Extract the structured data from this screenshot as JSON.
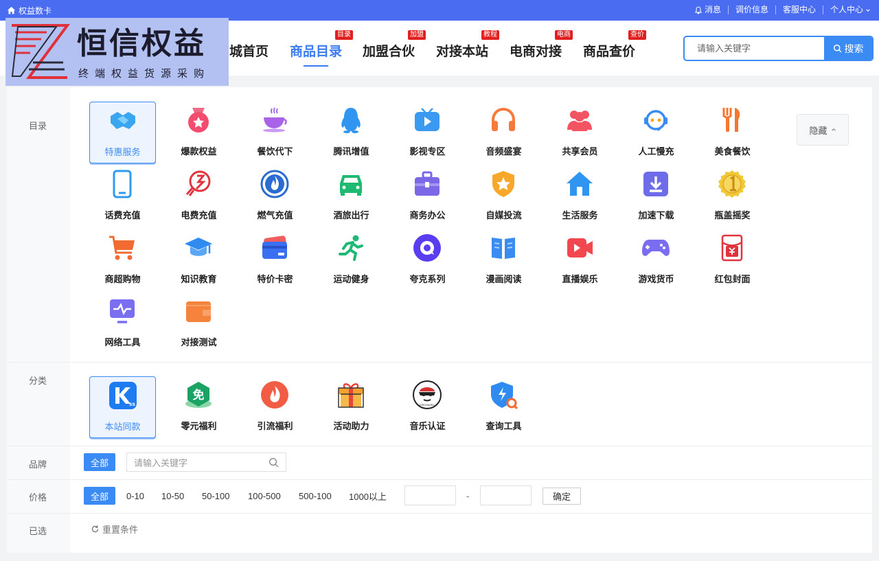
{
  "topbar": {
    "site_name": "权益数卡",
    "links": [
      {
        "label": "消息",
        "icon": "bell-icon"
      },
      {
        "label": "调价信息"
      },
      {
        "label": "客服中心"
      },
      {
        "label": "个人中心",
        "icon": "chevron-down-icon"
      }
    ]
  },
  "logo": {
    "title": "恒信权益",
    "subtitle": "终端权益货源采购",
    "bg_color": "#b2c1f2"
  },
  "nav": [
    {
      "label": "城首页",
      "tag": ""
    },
    {
      "label": "商品目录",
      "tag": "目录",
      "active": true
    },
    {
      "label": "加盟合伙",
      "tag": "加盟"
    },
    {
      "label": "对接本站",
      "tag": "教程"
    },
    {
      "label": "电商对接",
      "tag": "电商"
    },
    {
      "label": "商品查价",
      "tag": "查价"
    }
  ],
  "search": {
    "placeholder": "请输入关键字",
    "button": "搜索"
  },
  "catalog": {
    "label": "目录",
    "hide_label": "隐藏",
    "items": [
      {
        "label": "特惠服务",
        "icon": "handshake-icon",
        "selected": true
      },
      {
        "label": "爆款权益",
        "icon": "medal-icon"
      },
      {
        "label": "餐饮代下",
        "icon": "coffee-cup-icon"
      },
      {
        "label": "腾讯增值",
        "icon": "qq-penguin-icon"
      },
      {
        "label": "影视专区",
        "icon": "tv-play-icon"
      },
      {
        "label": "音频盛宴",
        "icon": "headphones-icon"
      },
      {
        "label": "共享会员",
        "icon": "users-icon"
      },
      {
        "label": "人工慢充",
        "icon": "support-agent-icon"
      },
      {
        "label": "美食餐饮",
        "icon": "fork-knife-icon"
      },
      {
        "label": "话费充值",
        "icon": "phone-icon"
      },
      {
        "label": "电费充值",
        "icon": "electric-icon"
      },
      {
        "label": "燃气充值",
        "icon": "flame-icon"
      },
      {
        "label": "酒旅出行",
        "icon": "car-icon"
      },
      {
        "label": "商务办公",
        "icon": "briefcase-icon"
      },
      {
        "label": "自媒投流",
        "icon": "shield-star-icon"
      },
      {
        "label": "生活服务",
        "icon": "house-icon"
      },
      {
        "label": "加速下载",
        "icon": "download-icon"
      },
      {
        "label": "瓶盖摇奖",
        "icon": "gold-coin-icon"
      },
      {
        "label": "商超购物",
        "icon": "shopping-cart-icon"
      },
      {
        "label": "知识教育",
        "icon": "graduation-cap-icon"
      },
      {
        "label": "特价卡密",
        "icon": "card-icon"
      },
      {
        "label": "运动健身",
        "icon": "running-icon"
      },
      {
        "label": "夸克系列",
        "icon": "quark-icon"
      },
      {
        "label": "漫画阅读",
        "icon": "book-icon"
      },
      {
        "label": "直播娱乐",
        "icon": "video-camera-icon"
      },
      {
        "label": "游戏货币",
        "icon": "gamepad-icon"
      },
      {
        "label": "红包封面",
        "icon": "red-envelope-icon"
      },
      {
        "label": "网络工具",
        "icon": "monitor-pulse-icon"
      },
      {
        "label": "对接测试",
        "icon": "wallet-icon"
      }
    ]
  },
  "category": {
    "label": "分类",
    "items": [
      {
        "label": "本站同款",
        "icon": "k-logo-icon",
        "selected": true
      },
      {
        "label": "零元福利",
        "icon": "free-badge-icon"
      },
      {
        "label": "引流福利",
        "icon": "fire-icon"
      },
      {
        "label": "活动助力",
        "icon": "gift-box-icon"
      },
      {
        "label": "音乐认证",
        "icon": "music-avatar-icon"
      },
      {
        "label": "查询工具",
        "icon": "shield-search-icon"
      }
    ]
  },
  "brand": {
    "label": "品牌",
    "all": "全部",
    "placeholder": "请输入关键字"
  },
  "price": {
    "label": "价格",
    "all": "全部",
    "ranges": [
      "0-10",
      "10-50",
      "50-100",
      "100-500",
      "500-100",
      "1000以上"
    ],
    "dash": "-",
    "confirm": "确定"
  },
  "selected": {
    "label": "已选",
    "reset": "重置条件"
  },
  "colors": {
    "accent": "#3b8bf5",
    "topbar": "#4a6cf0",
    "tag_red": "#e02020"
  }
}
